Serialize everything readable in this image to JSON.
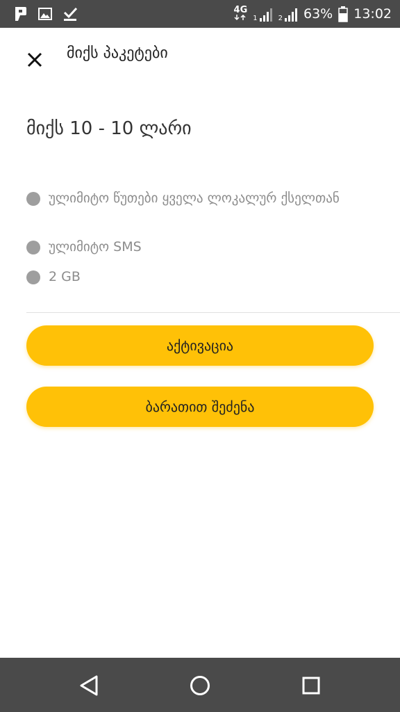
{
  "status_bar": {
    "left_icons": [
      "app-p-icon",
      "image-icon",
      "download-done-icon"
    ],
    "network_type": "4G",
    "sim1_label": "1",
    "sim2_label": "2",
    "battery_percent": "63%",
    "battery_level": 0.63,
    "time": "13:02"
  },
  "header": {
    "close_icon": "close-icon",
    "title": "მიქს პაკეტები"
  },
  "package": {
    "title": "მიქს 10 - 10 ლარი",
    "features": [
      {
        "text": "ულიმიტო წუთები ყველა ლოკალურ ქსელთან"
      },
      {
        "text": "ულიმიტო SMS"
      },
      {
        "text": "2 GB"
      }
    ]
  },
  "actions": {
    "activate_label": "აქტივაცია",
    "buy_with_card_label": "ბარათით შეძენა",
    "button_color": "#ffc107"
  },
  "nav_bar": {
    "back_icon": "back-triangle-icon",
    "home_icon": "home-circle-icon",
    "recent_icon": "recent-square-icon"
  }
}
